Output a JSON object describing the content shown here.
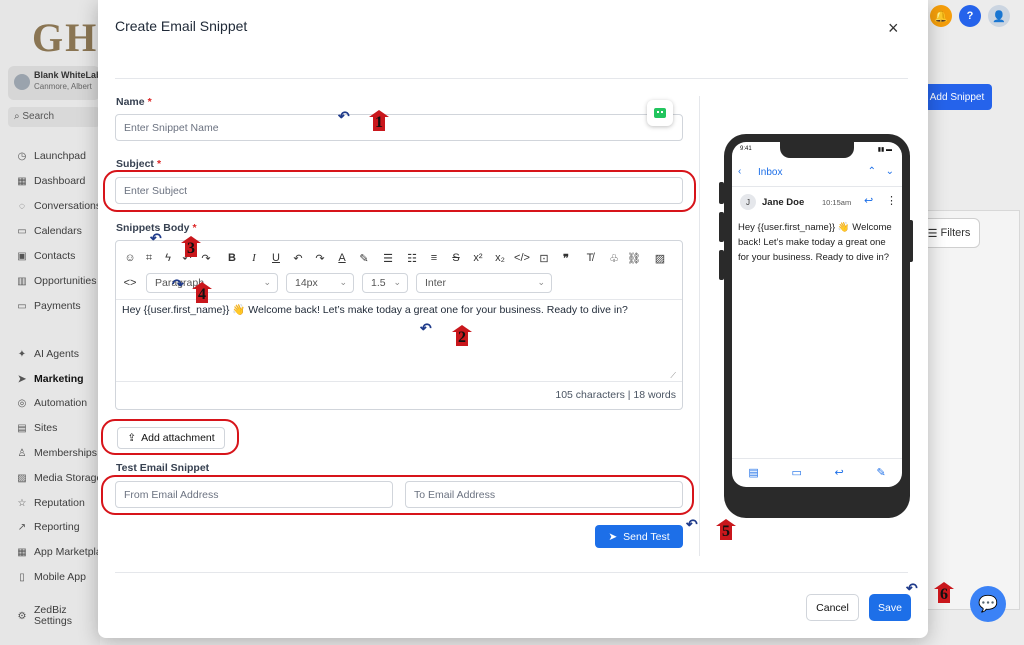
{
  "background": {
    "logo": "GH",
    "account_name": "Blank WhiteLabel",
    "account_location": "Canmore, Albert",
    "search_label": "Search",
    "nav_items": [
      "Launchpad",
      "Dashboard",
      "Conversations",
      "Calendars",
      "Contacts",
      "Opportunities",
      "Payments",
      "AI Agents",
      "Marketing",
      "Automation",
      "Sites",
      "Memberships",
      "Media Storage",
      "Reputation",
      "Reporting",
      "App Marketplace",
      "Mobile App",
      "ZedBiz Settings"
    ],
    "add_snippet_label": "Add Snippet",
    "filters_label": "Filters",
    "help_label": "?"
  },
  "modal": {
    "title": "Create Email Snippet",
    "close": "×",
    "name_label": "Name",
    "name_placeholder": "Enter Snippet Name",
    "subject_label": "Subject",
    "subject_placeholder": "Enter Subject",
    "required_mark": "*",
    "body_label": "Snippets Body",
    "toolbar": {
      "paragraph": "Paragraph",
      "font_size": "14px",
      "line_height": "1.5",
      "font_family": "Inter"
    },
    "body_text": "Hey {{user.first_name}} 👋 Welcome back! Let’s make today a great one for your business. Ready to dive in?",
    "counter": "105 characters | 18 words",
    "add_attachment": "Add attachment",
    "test_label": "Test Email Snippet",
    "from_placeholder": "From Email Address",
    "to_placeholder": "To Email Address",
    "send_test": "Send Test",
    "cancel": "Cancel",
    "save": "Save"
  },
  "phone": {
    "time": "9:41",
    "inbox": "Inbox",
    "sender_initial": "J",
    "sender_name": "Jane Doe",
    "sent_time": "10:15am",
    "body": "Hey {{user.first_name}} 👋 Welcome back! Let’s make today a great one for your business. Ready to dive in?"
  },
  "annotations": [
    "1",
    "2",
    "3",
    "4",
    "5",
    "6"
  ],
  "colors": {
    "primary": "#1d6fe8",
    "annotation_red": "#d7141a",
    "required": "#dc2626"
  }
}
